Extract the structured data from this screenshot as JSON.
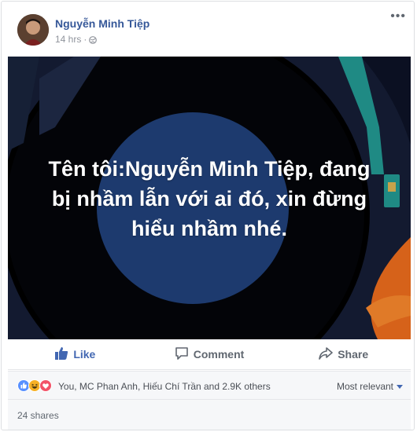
{
  "post": {
    "author": "Nguyễn Minh Tiệp",
    "time": "14 hrs",
    "privacy_icon": "globe-icon",
    "more_icon": "more-dots-icon",
    "image_caption": "Tên tôi:Nguyễn Minh Tiệp, đang\nbị nhầm lẫn với ai đó, xin đừng\nhiểu nhầm nhé."
  },
  "actions": {
    "like": "Like",
    "comment": "Comment",
    "share": "Share"
  },
  "reactions": {
    "icons": [
      "like-reaction-icon",
      "haha-reaction-icon",
      "love-reaction-icon"
    ],
    "summary": "You, MC Phan Anh, Hiếu Chí Trần and 2.9K others",
    "sort_label": "Most relevant"
  },
  "shares": "24 shares",
  "colors": {
    "link_blue": "#365899",
    "like_blue": "#4267b2",
    "image_bg": "#0b1022",
    "disc_blue": "#1d3a6e",
    "tonearm_teal": "#1f8a84",
    "accent_orange": "#d6621a"
  }
}
